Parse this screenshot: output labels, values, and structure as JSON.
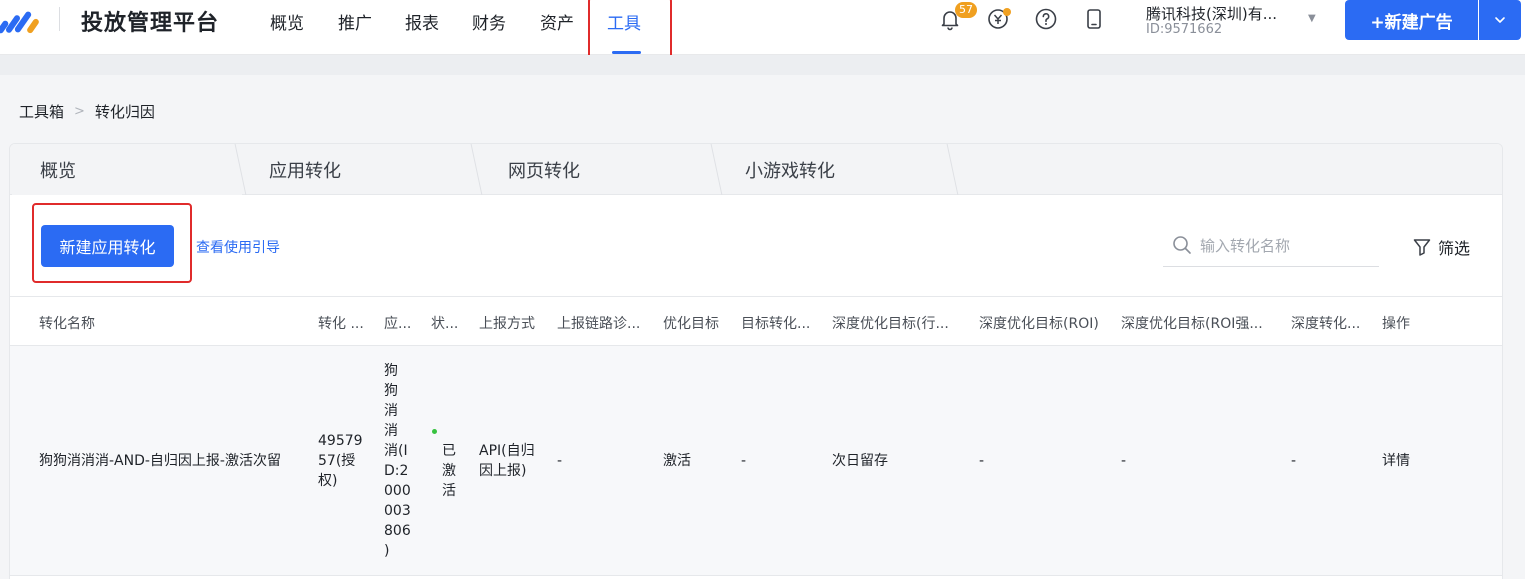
{
  "header": {
    "title": "投放管理平台",
    "nav": [
      {
        "label": "概览"
      },
      {
        "label": "推广"
      },
      {
        "label": "报表"
      },
      {
        "label": "财务"
      },
      {
        "label": "资产"
      },
      {
        "label": "工具",
        "active": true
      }
    ],
    "notification_count": "57",
    "account": {
      "name": "腾讯科技(深圳)有...",
      "id": "ID:9571662"
    },
    "new_ad_label": "+新建广告",
    "icons": [
      "bell-icon",
      "coin-icon",
      "help-icon",
      "mobile-icon",
      "chevron-down-icon"
    ]
  },
  "breadcrumb": {
    "items": [
      "工具箱",
      "转化归因"
    ]
  },
  "tabs": [
    {
      "label": "概览"
    },
    {
      "label": "应用转化",
      "active": true
    },
    {
      "label": "网页转化"
    },
    {
      "label": "小游戏转化"
    }
  ],
  "toolbar": {
    "create_label": "新建应用转化",
    "guide_label": "查看使用引导",
    "search_placeholder": "输入转化名称",
    "filter_label": "筛选"
  },
  "table": {
    "columns": [
      "转化名称",
      "转化 ...",
      "应...",
      "状...",
      "上报方式",
      "上报链路诊...",
      "优化目标",
      "目标转化...",
      "深度优化目标(行...",
      "深度优化目标(ROI)",
      "深度优化目标(ROI强...",
      "深度转化...",
      "操作"
    ],
    "rows": [
      {
        "name": "狗狗消消消-AND-自归因上报-激活次留",
        "conversion_id": "49579\n57(授\n权)",
        "app": "狗\n狗\n消\n消\n消(I\nD:2\n000\n003\n806\n)",
        "status": "已\n激\n活",
        "report_method": "API(自归\n因上报)",
        "diagnosis": "-",
        "optimization_goal": "激活",
        "target_conversion": "-",
        "deep_goal_action": "次日留存",
        "deep_goal_roi": "-",
        "deep_goal_roi_strong": "-",
        "deep_conversion": "-",
        "action": "详情"
      }
    ]
  },
  "colors": {
    "primary": "#2b6bf3",
    "highlight": "#e02b2b",
    "badge": "#f0a020",
    "status_active": "#37c23f"
  }
}
